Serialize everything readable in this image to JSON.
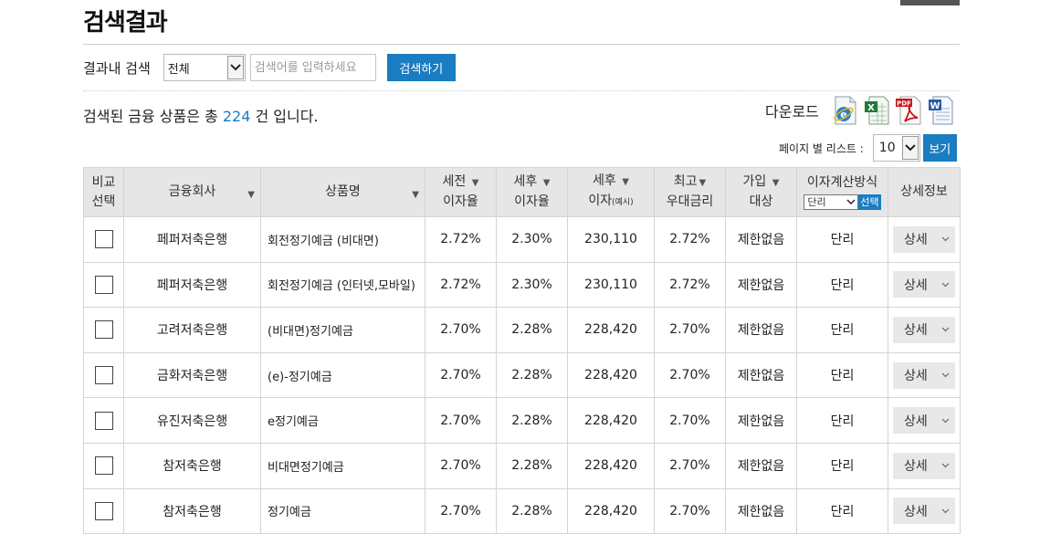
{
  "page": {
    "title": "검색결과"
  },
  "search": {
    "label": "결과내 검색",
    "scope_value": "전체",
    "placeholder": "검색어를 입력하세요",
    "button_label": "검색하기"
  },
  "results": {
    "prefix": "검색된 금융 상품은 총 ",
    "count": "224",
    "suffix": " 건 입니다."
  },
  "download": {
    "label": "다운로드",
    "icons": [
      "ie-icon",
      "excel-icon",
      "pdf-icon",
      "word-icon"
    ]
  },
  "paging": {
    "label": "페이지 별 리스트 :",
    "value": "10",
    "button_label": "보기"
  },
  "table": {
    "headers": {
      "compare_line1": "비교",
      "compare_line2": "선택",
      "company": "금융회사",
      "product": "상품명",
      "pretax_line1": "세전",
      "pretax_line2": "이자율",
      "aftertax_line1": "세후",
      "aftertax_line2": "이자율",
      "interest_line1": "세후",
      "interest_line2": "이자",
      "interest_note": "(예시)",
      "max_line1": "최고",
      "max_line2": "우대금리",
      "join_line1": "가입",
      "join_line2": "대상",
      "calc_label": "이자계산방식",
      "calc_value": "단리",
      "calc_button": "선택",
      "detail": "상세정보"
    },
    "sort_glyph": "▼",
    "rows": [
      {
        "company": "페퍼저축은행",
        "product": "회전정기예금 (비대면)",
        "pretax": "2.72%",
        "aftertax": "2.30%",
        "interest": "230,110",
        "max_rate": "2.72%",
        "target": "제한없음",
        "calc": "단리",
        "detail": "상세"
      },
      {
        "company": "페퍼저축은행",
        "product": "회전정기예금 (인터넷,모바일)",
        "pretax": "2.72%",
        "aftertax": "2.30%",
        "interest": "230,110",
        "max_rate": "2.72%",
        "target": "제한없음",
        "calc": "단리",
        "detail": "상세"
      },
      {
        "company": "고려저축은행",
        "product": "(비대면)정기예금",
        "pretax": "2.70%",
        "aftertax": "2.28%",
        "interest": "228,420",
        "max_rate": "2.70%",
        "target": "제한없음",
        "calc": "단리",
        "detail": "상세"
      },
      {
        "company": "금화저축은행",
        "product": "(e)-정기예금",
        "pretax": "2.70%",
        "aftertax": "2.28%",
        "interest": "228,420",
        "max_rate": "2.70%",
        "target": "제한없음",
        "calc": "단리",
        "detail": "상세"
      },
      {
        "company": "유진저축은행",
        "product": "e정기예금",
        "pretax": "2.70%",
        "aftertax": "2.28%",
        "interest": "228,420",
        "max_rate": "2.70%",
        "target": "제한없음",
        "calc": "단리",
        "detail": "상세"
      },
      {
        "company": "참저축은행",
        "product": "비대면정기예금",
        "pretax": "2.70%",
        "aftertax": "2.28%",
        "interest": "228,420",
        "max_rate": "2.70%",
        "target": "제한없음",
        "calc": "단리",
        "detail": "상세"
      },
      {
        "company": "참저축은행",
        "product": "정기예금",
        "pretax": "2.70%",
        "aftertax": "2.28%",
        "interest": "228,420",
        "max_rate": "2.70%",
        "target": "제한없음",
        "calc": "단리",
        "detail": "상세"
      }
    ]
  }
}
